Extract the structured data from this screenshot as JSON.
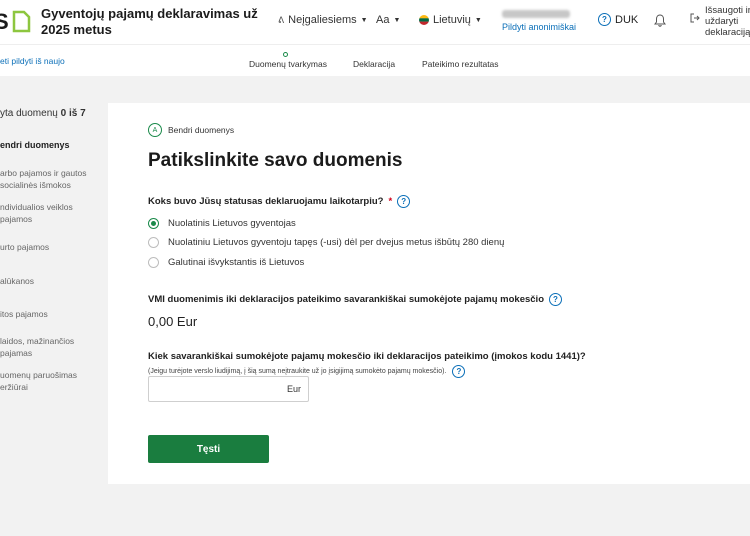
{
  "header": {
    "title": "Gyventojų pajamų deklaravimas už 2025 metus",
    "accessibility_label": "Neįgaliesiems",
    "font_size_label": "Aa",
    "language_label": "Lietuvių",
    "anonymous_link": "Pildyti anonimiškai",
    "faq_label": "DUK",
    "save_exit_label": "Išsaugoti ir uždaryti deklaraciją",
    "accent_color": "#0b6fb8"
  },
  "subbar": {
    "restart_link": "eti pildyti iš naujo",
    "steps": [
      "Duomenų tvarkymas",
      "Deklaracija",
      "Pateikimo rezultatas"
    ]
  },
  "sidebar": {
    "progress_prefix": "yta duomenų",
    "progress_value": "0 iš 7",
    "items": [
      "endri duomenys",
      "arbo pajamos ir gautos socialinės išmokos",
      "ndividualios veiklos pajamos",
      "urto pajamos",
      "alūkanos",
      "itos pajamos",
      "laidos, mažinančios pajamas",
      "uomenų paruošimas eržiūrai"
    ]
  },
  "main": {
    "section_badge": "A",
    "section_label": "Bendri duomenys",
    "title": "Patikslinkite savo duomenis",
    "q1": "Koks buvo Jūsų statusas deklaruojamu laikotarpiu?",
    "q1_required": "*",
    "options": [
      "Nuolatinis Lietuvos gyventojas",
      "Nuolatiniu Lietuvos gyventoju tapęs (-usi) dėl per dvejus metus išbūtų 280 dienų",
      "Galutinai išvykstantis iš Lietuvos"
    ],
    "selected_option": 0,
    "q2": "VMI duomenimis iki deklaracijos pateikimo savarankiškai sumokėjote pajamų mokesčio",
    "q2_amount": "0,00 Eur",
    "q3": "Kiek savarankiškai sumokėjote pajamų mokesčio iki deklaracijos pateikimo (įmokos kodu 1441)?",
    "q3_hint": "(Jeigu turėjote verslo liudijimą, į šią sumą neįtraukite už jo įsigijimą sumokėto pajamų mokesčio).",
    "input_value": "",
    "input_suffix": "Eur",
    "next_button": "Tęsti",
    "button_color": "#1a7d3f",
    "help_glyph": "?"
  }
}
